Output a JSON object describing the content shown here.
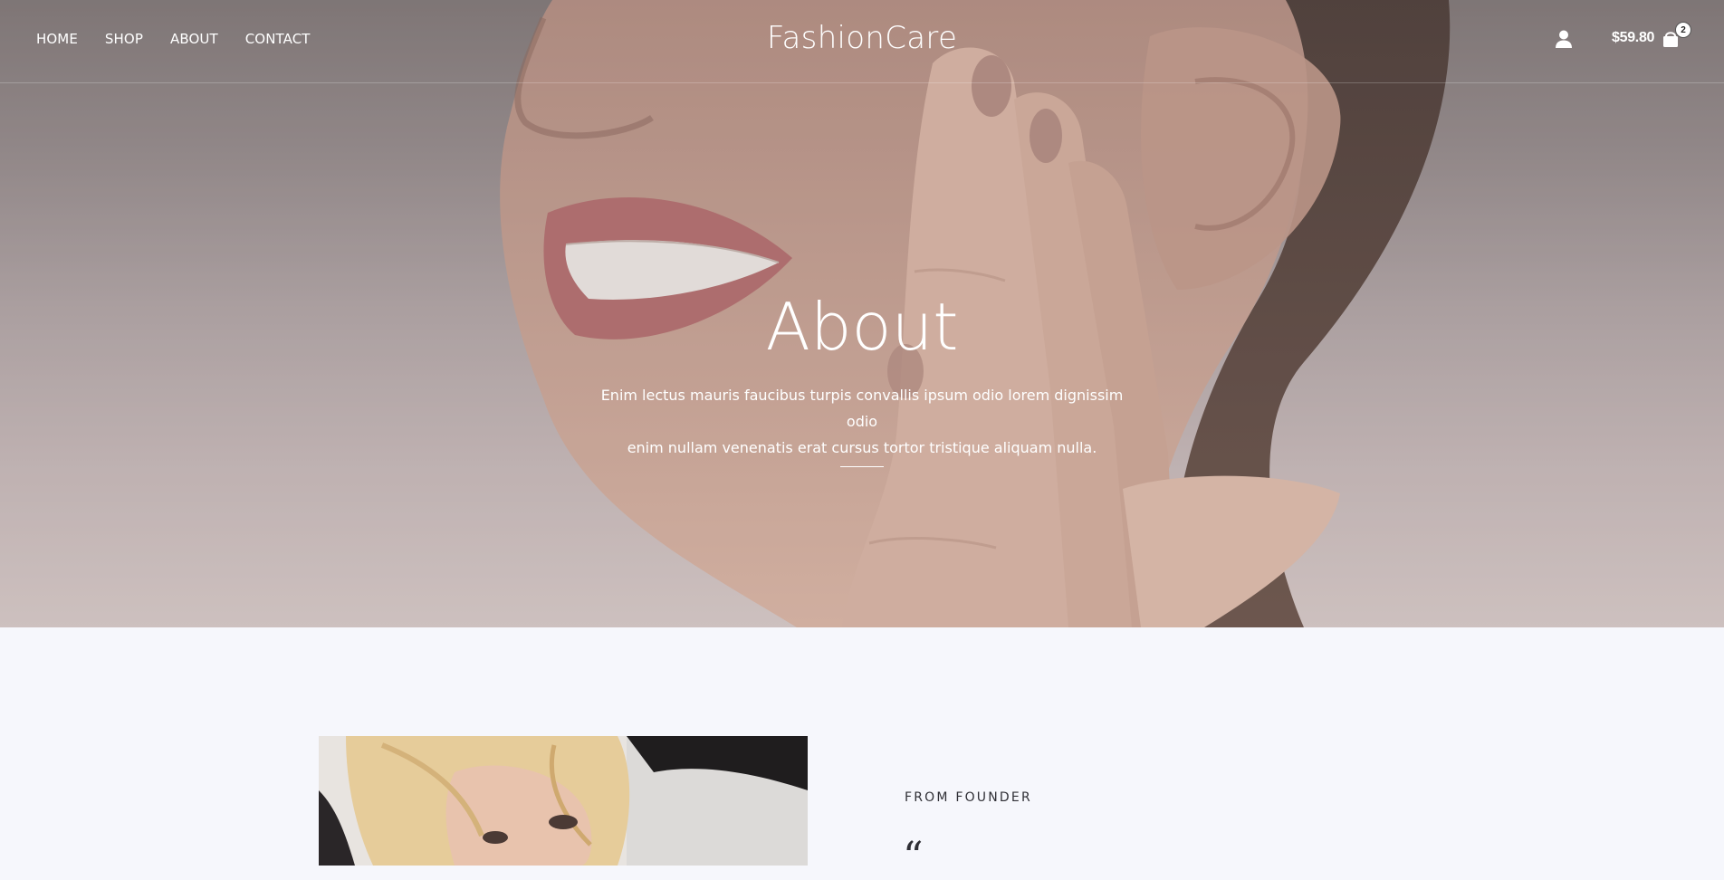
{
  "header": {
    "nav": [
      {
        "label": "HOME"
      },
      {
        "label": "SHOP"
      },
      {
        "label": "ABOUT"
      },
      {
        "label": "CONTACT"
      }
    ],
    "logo": "FashionCare",
    "cart_total": "$59.80",
    "cart_count": "2",
    "icons": {
      "account": "user-icon",
      "cart": "shopping-bag-icon"
    }
  },
  "hero": {
    "title": "About",
    "subtitle_line1": "Enim lectus mauris faucibus turpis convallis ipsum odio lorem dignissim odio",
    "subtitle_line2": "enim nullam venenatis erat cursus tortor tristique aliquam nulla."
  },
  "founder": {
    "label": "FROM FOUNDER",
    "quote_mark": "“"
  },
  "colors": {
    "hero_top": "#7c7474",
    "hero_bottom": "#dccfcd",
    "text_light": "#ffffff",
    "text_dark": "#2f2f35",
    "page_bg": "#f6f7fc"
  }
}
